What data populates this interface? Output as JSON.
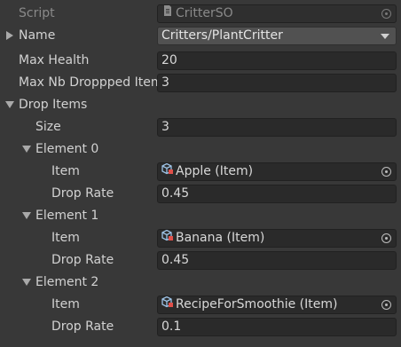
{
  "script": {
    "label": "Script",
    "value": "CritterSO"
  },
  "name": {
    "label": "Name",
    "value": "Critters/PlantCritter"
  },
  "max_health": {
    "label": "Max Health",
    "value": "20"
  },
  "max_nb_dropped": {
    "label": "Max Nb Droppped Items",
    "value": "3"
  },
  "drop_items": {
    "label": "Drop Items",
    "size_label": "Size",
    "size_value": "3",
    "item_label": "Item",
    "rate_label": "Drop Rate",
    "elements": [
      {
        "label": "Element 0",
        "item": "Apple (Item)",
        "rate": "0.45"
      },
      {
        "label": "Element 1",
        "item": "Banana (Item)",
        "rate": "0.45"
      },
      {
        "label": "Element 2",
        "item": "RecipeForSmoothie (Item)",
        "rate": "0.1"
      }
    ]
  },
  "icons": {
    "script": "script-asset-icon",
    "item": "scriptable-object-icon",
    "picker": "object-picker-icon",
    "foldout": "foldout-arrow-icon"
  },
  "colors": {
    "background": "#383838",
    "field": "#2a2a2a",
    "dropdown": "#515151",
    "text": "#d2d2d2",
    "disabled_text": "#8a8a8a"
  }
}
